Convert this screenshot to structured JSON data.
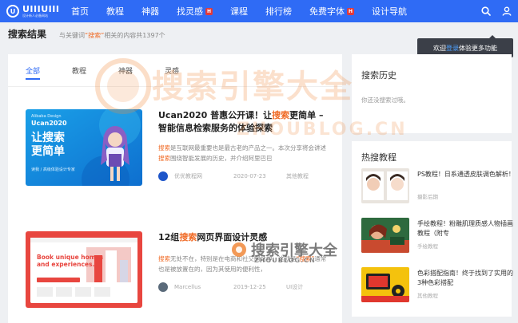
{
  "brand": {
    "name": "UIIIUIII",
    "tagline": "设计新人必备网站"
  },
  "nav": [
    {
      "label": "首页",
      "hot": false
    },
    {
      "label": "教程",
      "hot": false
    },
    {
      "label": "神器",
      "hot": false
    },
    {
      "label": "找灵感",
      "hot": true
    },
    {
      "label": "课程",
      "hot": false
    },
    {
      "label": "排行榜",
      "hot": false
    },
    {
      "label": "免费字体",
      "hot": true
    },
    {
      "label": "设计导航",
      "hot": false
    }
  ],
  "hot_badge": "H",
  "header": {
    "title": "搜索结果",
    "sub_prefix": "与关键词",
    "keyword": "“搜索”",
    "sub_suffix": "相关的内容共1397个"
  },
  "tooltip": {
    "prefix": "欢迎",
    "link": "登录",
    "suffix": "体验更多功能"
  },
  "tabs": [
    "全部",
    "教程",
    "神器",
    "灵感"
  ],
  "articles": [
    {
      "title_pre": "Ucan2020 普惠公开课！让",
      "title_kw": "搜索",
      "title_post": "更简单 – 智能信息检索服务的体验探索",
      "desc_kw1": "搜索",
      "desc_mid": "是互联网最重要也是最古老的产品之一。本次分享将会讲述",
      "desc_kw2": "搜索",
      "desc_post": "围绕智能发展的历史，并介绍阿里巴巴",
      "author": "优优教程网",
      "date": "2020-07-23",
      "category": "其他教程",
      "thumb": {
        "brand": "Alibaba Design",
        "event": "Ucan2020",
        "line1": "让搜索",
        "line2": "更简单",
        "caption": "读我 / 高级体验设计专家"
      }
    },
    {
      "title_pre": "12组",
      "title_kw": "搜索",
      "title_post": "网页界面设计灵感",
      "desc_kw1": "搜索",
      "desc_mid": "无处不在，特别是在电商和社交网站中。这就是",
      "desc_kw2": "“搜索”",
      "desc_post": "通常也是被放置在的，因为其使用的便利性，",
      "author": "Marcellus",
      "date": "2019-12-25",
      "category": "UI设计",
      "thumb": {
        "line1": "Book unique homes",
        "line2": "and experiences."
      }
    }
  ],
  "sidebar": {
    "history_title": "搜索历史",
    "history_empty": "你还没搜索过哦。",
    "hot_title": "热搜教程",
    "hot": [
      {
        "title": "PS教程！日系通透皮肤调色解析！",
        "category": "摄影后期"
      },
      {
        "title": "手绘教程！粉雕肌理质感人物插画教程（附专",
        "category": "手绘教程"
      },
      {
        "title": "色彩搭配指南！终于找到了实用的3种色彩搭配",
        "category": "其他教程"
      }
    ]
  },
  "watermark": {
    "main": "搜索引擎大全",
    "url": "ZHOUBLOG.CN"
  },
  "colors": {
    "brand_blue": "#2f6bf5",
    "keyword_orange": "#f06a25",
    "hot_red": "#e33a3a"
  }
}
